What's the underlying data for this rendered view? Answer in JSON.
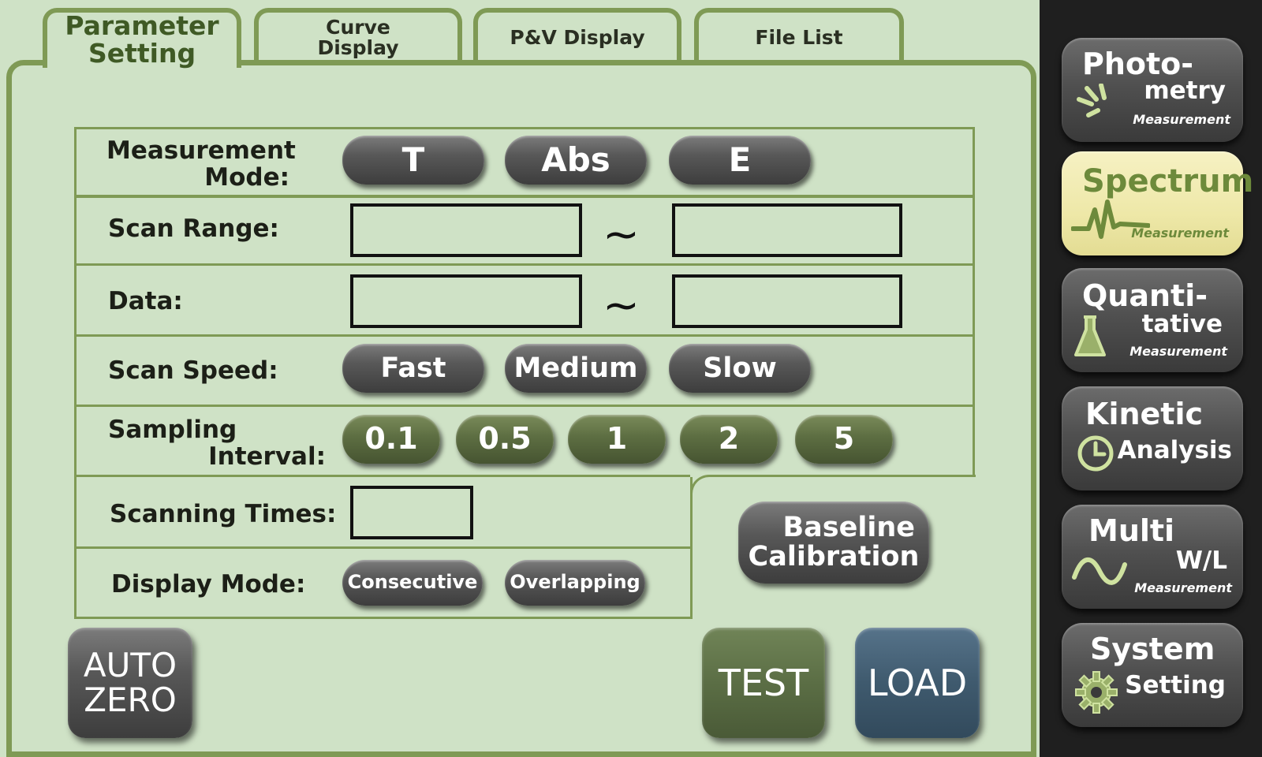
{
  "tabs": [
    {
      "line1": "Parameter",
      "line2": "Setting",
      "active": true
    },
    {
      "line1": "Curve",
      "line2": "Display",
      "active": false
    },
    {
      "line1": "P&V Display",
      "line2": "",
      "active": false
    },
    {
      "line1": "File List",
      "line2": "",
      "active": false
    }
  ],
  "params": {
    "measurement_mode": {
      "label_line1": "Measurement",
      "label_line2": "Mode:",
      "options": [
        "T",
        "Abs",
        "E"
      ]
    },
    "scan_range": {
      "label": "Scan Range:",
      "from": "",
      "to": "",
      "separator": "~"
    },
    "data": {
      "label": "Data:",
      "from": "",
      "to": "",
      "separator": "~"
    },
    "scan_speed": {
      "label": "Scan Speed:",
      "options": [
        "Fast",
        "Medium",
        "Slow"
      ]
    },
    "sampling_interval": {
      "label_line1": "Sampling",
      "label_line2": "Interval:",
      "options": [
        "0.1",
        "0.5",
        "1",
        "2",
        "5"
      ]
    },
    "scanning_times": {
      "label": "Scanning Times:",
      "value": ""
    },
    "display_mode": {
      "label": "Display Mode:",
      "options": [
        "Consecutive",
        "Overlapping"
      ]
    }
  },
  "buttons": {
    "baseline_line1": "Baseline",
    "baseline_line2": "Calibration",
    "auto_zero_line1": "AUTO",
    "auto_zero_line2": "ZERO",
    "test": "TEST",
    "load": "LOAD"
  },
  "sidebar": [
    {
      "t1": "Photo-",
      "t2": "metry",
      "t3": "Measurement",
      "icon": "light-rays-icon",
      "active": false
    },
    {
      "t1": "Spectrum",
      "t2": "",
      "t3": "Measurement",
      "icon": "waveform-icon",
      "active": true
    },
    {
      "t1": "Quanti-",
      "t2": "tative",
      "t3": "Measurement",
      "icon": "flask-icon",
      "active": false
    },
    {
      "t1": "Kinetic",
      "t2": "Analysis",
      "t3": "",
      "icon": "clock-icon",
      "active": false
    },
    {
      "t1": "Multi",
      "t2": "W/L",
      "t3": "Measurement",
      "icon": "sine-wave-icon",
      "active": false
    },
    {
      "t1": "System",
      "t2": "Setting",
      "t3": "",
      "icon": "gear-icon",
      "active": false
    }
  ],
  "colors": {
    "background": "#cfe2c6",
    "border_green": "#7f9a55",
    "button_dark": "#505050",
    "button_green": "#5d6e42",
    "test_button": "#5b6e45",
    "load_button": "#3f5a6e",
    "sidebar_bg": "#1f1f1f",
    "active_side_bg": "#eee8a8"
  }
}
